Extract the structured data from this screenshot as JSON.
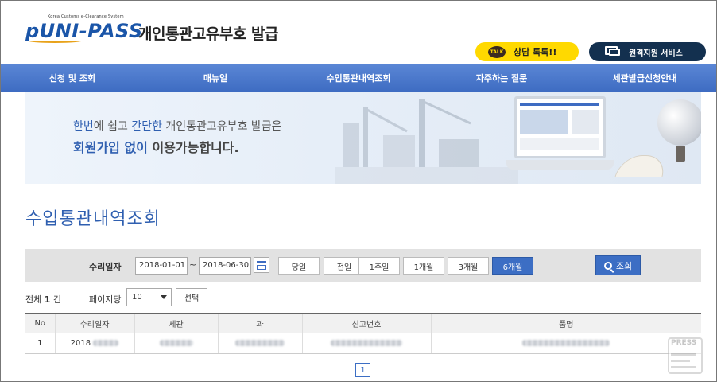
{
  "header": {
    "logo_small": "Korea Customs e-Clearance System",
    "logo_text": "pUNI-PASS",
    "title": "개인통관고유부호 발급",
    "talk_button": "상담 톡톡!!",
    "talk_icon_text": "TALK",
    "remote_button": "원격지원 서비스"
  },
  "nav": {
    "items": [
      "신청 및 조회",
      "매뉴얼",
      "수입통관내역조회",
      "자주하는 질문",
      "세관발급신청안내"
    ]
  },
  "banner": {
    "line1_a": "한번",
    "line1_b": "에 쉽고 ",
    "line1_c": "간단한",
    "line1_d": " 개인통관고유부호 발급은",
    "line2_a": "회원가입 없이",
    "line2_b": " 이용가능합니다."
  },
  "page_title": "수입통관내역조회",
  "search": {
    "label": "수리일자",
    "start_date": "2018-01-01",
    "end_date": "2018-06-30",
    "separator": "~",
    "periods": [
      "당일",
      "전일",
      "1주일",
      "1개월",
      "3개월",
      "6개월"
    ],
    "active_period": "6개월",
    "search_button": "조회"
  },
  "results": {
    "total_prefix": "전체 ",
    "total_count": "1",
    "total_suffix": " 건",
    "per_page_label": "페이지당",
    "per_page_value": "10",
    "select_button": "선택"
  },
  "table": {
    "headers": [
      "No",
      "수리일자",
      "세관",
      "과",
      "신고번호",
      "품명"
    ],
    "rows": [
      {
        "no": "1",
        "date": "2018"
      }
    ]
  },
  "pagination": {
    "current": "1"
  },
  "press_icon_text": "PRESS"
}
